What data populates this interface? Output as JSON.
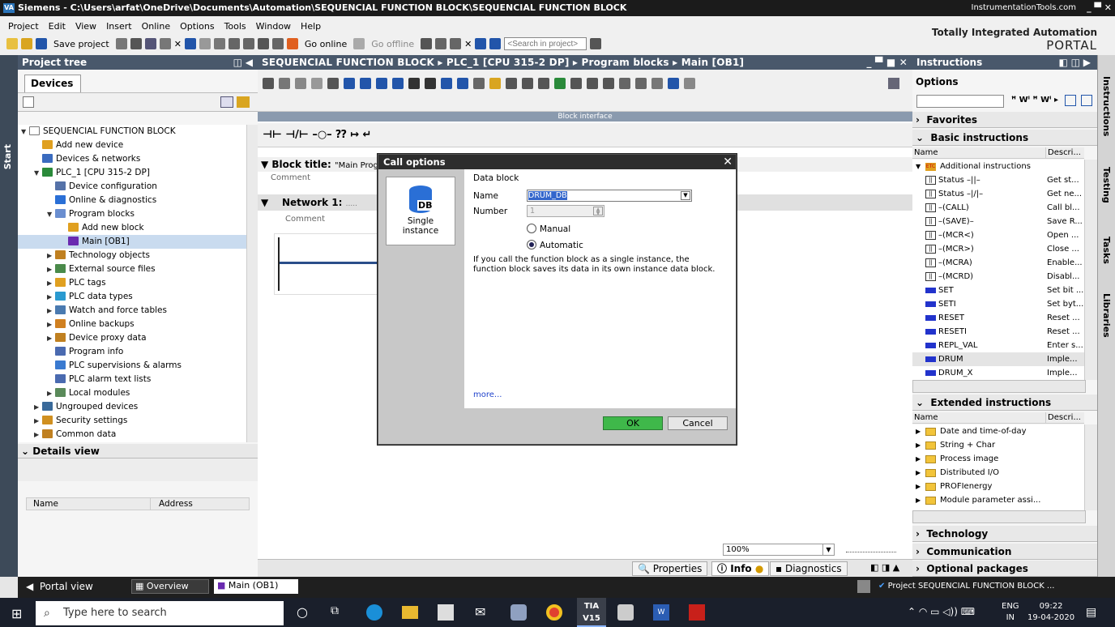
{
  "titlebar": {
    "logo": "VA",
    "title": "Siemens - C:\\Users\\arfat\\OneDrive\\Documents\\Automation\\SEQUENCIAL FUNCTION BLOCK\\SEQUENCIAL FUNCTION BLOCK",
    "brand": "InstrumentationTools.com",
    "controls": "_ ▀ ✕"
  },
  "menu": [
    "Project",
    "Edit",
    "View",
    "Insert",
    "Online",
    "Options",
    "Tools",
    "Window",
    "Help"
  ],
  "toolbar": {
    "save": "Save project",
    "go_online": "Go online",
    "go_offline": "Go offline",
    "search_placeholder": "<Search in project>"
  },
  "tia": {
    "line1": "Totally Integrated Automation",
    "line2": "PORTAL"
  },
  "start_label": "Start",
  "project_tree": {
    "title": "Project tree",
    "tab": "Devices",
    "items": [
      {
        "label": "SEQUENCIAL FUNCTION BLOCK",
        "toggle": "▼"
      },
      {
        "label": "Add new device",
        "toggle": ""
      },
      {
        "label": "Devices & networks",
        "toggle": ""
      },
      {
        "label": "PLC_1 [CPU 315-2 DP]",
        "toggle": "▼"
      },
      {
        "label": "Device configuration",
        "toggle": ""
      },
      {
        "label": "Online & diagnostics",
        "toggle": ""
      },
      {
        "label": "Program blocks",
        "toggle": "▼"
      },
      {
        "label": "Add new block",
        "toggle": ""
      },
      {
        "label": "Main [OB1]",
        "toggle": ""
      },
      {
        "label": "Technology objects",
        "toggle": "▶"
      },
      {
        "label": "External source files",
        "toggle": "▶"
      },
      {
        "label": "PLC tags",
        "toggle": "▶"
      },
      {
        "label": "PLC data types",
        "toggle": "▶"
      },
      {
        "label": "Watch and force tables",
        "toggle": "▶"
      },
      {
        "label": "Online backups",
        "toggle": "▶"
      },
      {
        "label": "Device proxy data",
        "toggle": "▶"
      },
      {
        "label": "Program info",
        "toggle": ""
      },
      {
        "label": "PLC supervisions & alarms",
        "toggle": ""
      },
      {
        "label": "PLC alarm text lists",
        "toggle": ""
      },
      {
        "label": "Local modules",
        "toggle": "▶"
      },
      {
        "label": "Ungrouped devices",
        "toggle": "▶"
      },
      {
        "label": "Security settings",
        "toggle": "▶"
      },
      {
        "label": "Common data",
        "toggle": "▶"
      }
    ],
    "details_view": "Details view",
    "col_name": "Name",
    "col_address": "Address"
  },
  "editor": {
    "breadcrumb": "SEQUENCIAL FUNCTION BLOCK ▸ PLC_1 [CPU 315-2 DP] ▸ Program blocks ▸ Main [OB1]",
    "block_interface": "Block interface",
    "ladder_symbols": "⊣⊢  ⊣/⊢  –○–  ⁇  ↦  ↵",
    "block_title_label": "Block title:",
    "block_title_value": "\"Main Progr",
    "comment": "Comment",
    "network": "Network 1:",
    "network_dots": ".....",
    "network_comment": "Comment",
    "zoom": "100%"
  },
  "bottom_tabs": {
    "properties": "Properties",
    "info": "Info",
    "diagnostics": "Diagnostics"
  },
  "instructions": {
    "title": "Instructions",
    "options": "Options",
    "favorites": "Favorites",
    "basic": "Basic instructions",
    "col_name": "Name",
    "col_desc": "Descri...",
    "basic_rows": [
      {
        "name": "Additional instructions",
        "desc": "",
        "icon": "folder"
      },
      {
        "name": "Status –||–",
        "desc": "Get st...",
        "icon": "box"
      },
      {
        "name": "Status –|/|–",
        "desc": "Get ne...",
        "icon": "box"
      },
      {
        "name": "–(CALL)",
        "desc": "Call bl...",
        "icon": "box"
      },
      {
        "name": "–(SAVE)–",
        "desc": "Save R...",
        "icon": "box"
      },
      {
        "name": "–(MCR<)",
        "desc": "Open ...",
        "icon": "box"
      },
      {
        "name": "–(MCR>)",
        "desc": "Close ...",
        "icon": "box"
      },
      {
        "name": "–(MCRA)",
        "desc": "Enable...",
        "icon": "box"
      },
      {
        "name": "–(MCRD)",
        "desc": "Disabl...",
        "icon": "box"
      },
      {
        "name": "SET",
        "desc": "Set bit ...",
        "icon": "blue"
      },
      {
        "name": "SETI",
        "desc": "Set byt...",
        "icon": "blue"
      },
      {
        "name": "RESET",
        "desc": "Reset ...",
        "icon": "blue"
      },
      {
        "name": "RESETI",
        "desc": "Reset ...",
        "icon": "blue"
      },
      {
        "name": "REPL_VAL",
        "desc": "Enter s...",
        "icon": "blue"
      },
      {
        "name": "DRUM",
        "desc": "Imple...",
        "icon": "blue"
      },
      {
        "name": "DRUM_X",
        "desc": "Imple...",
        "icon": "blue"
      }
    ],
    "extended": "Extended instructions",
    "ext_rows": [
      "Date and time-of-day",
      "String + Char",
      "Process image",
      "Distributed I/O",
      "PROFIenergy",
      "Module parameter assi..."
    ],
    "technology": "Technology",
    "communication": "Communication",
    "optional": "Optional packages"
  },
  "side_tabs": [
    "Instructions",
    "Testing",
    "Tasks",
    "Libraries"
  ],
  "statusbar": {
    "portal_view": "Portal view",
    "overview": "Overview",
    "main": "Main (OB1)",
    "project_msg": "Project SEQUENCIAL FUNCTION BLOCK ..."
  },
  "dialog": {
    "title": "Call options",
    "card_icon": "DB",
    "card_line1": "Single",
    "card_line2": "instance",
    "section": "Data block",
    "name_label": "Name",
    "name_value": "DRUM_DB",
    "number_label": "Number",
    "number_value": "1",
    "manual": "Manual",
    "automatic": "Automatic",
    "info": "If you call the function block as a single instance, the function block saves its data in its own instance data block.",
    "more": "more...",
    "ok": "OK",
    "cancel": "Cancel"
  },
  "taskbar": {
    "search": "Type here to search",
    "tia_app": "TIA V15",
    "lang1": "ENG",
    "lang2": "IN",
    "time": "09:22",
    "date": "19-04-2020"
  }
}
